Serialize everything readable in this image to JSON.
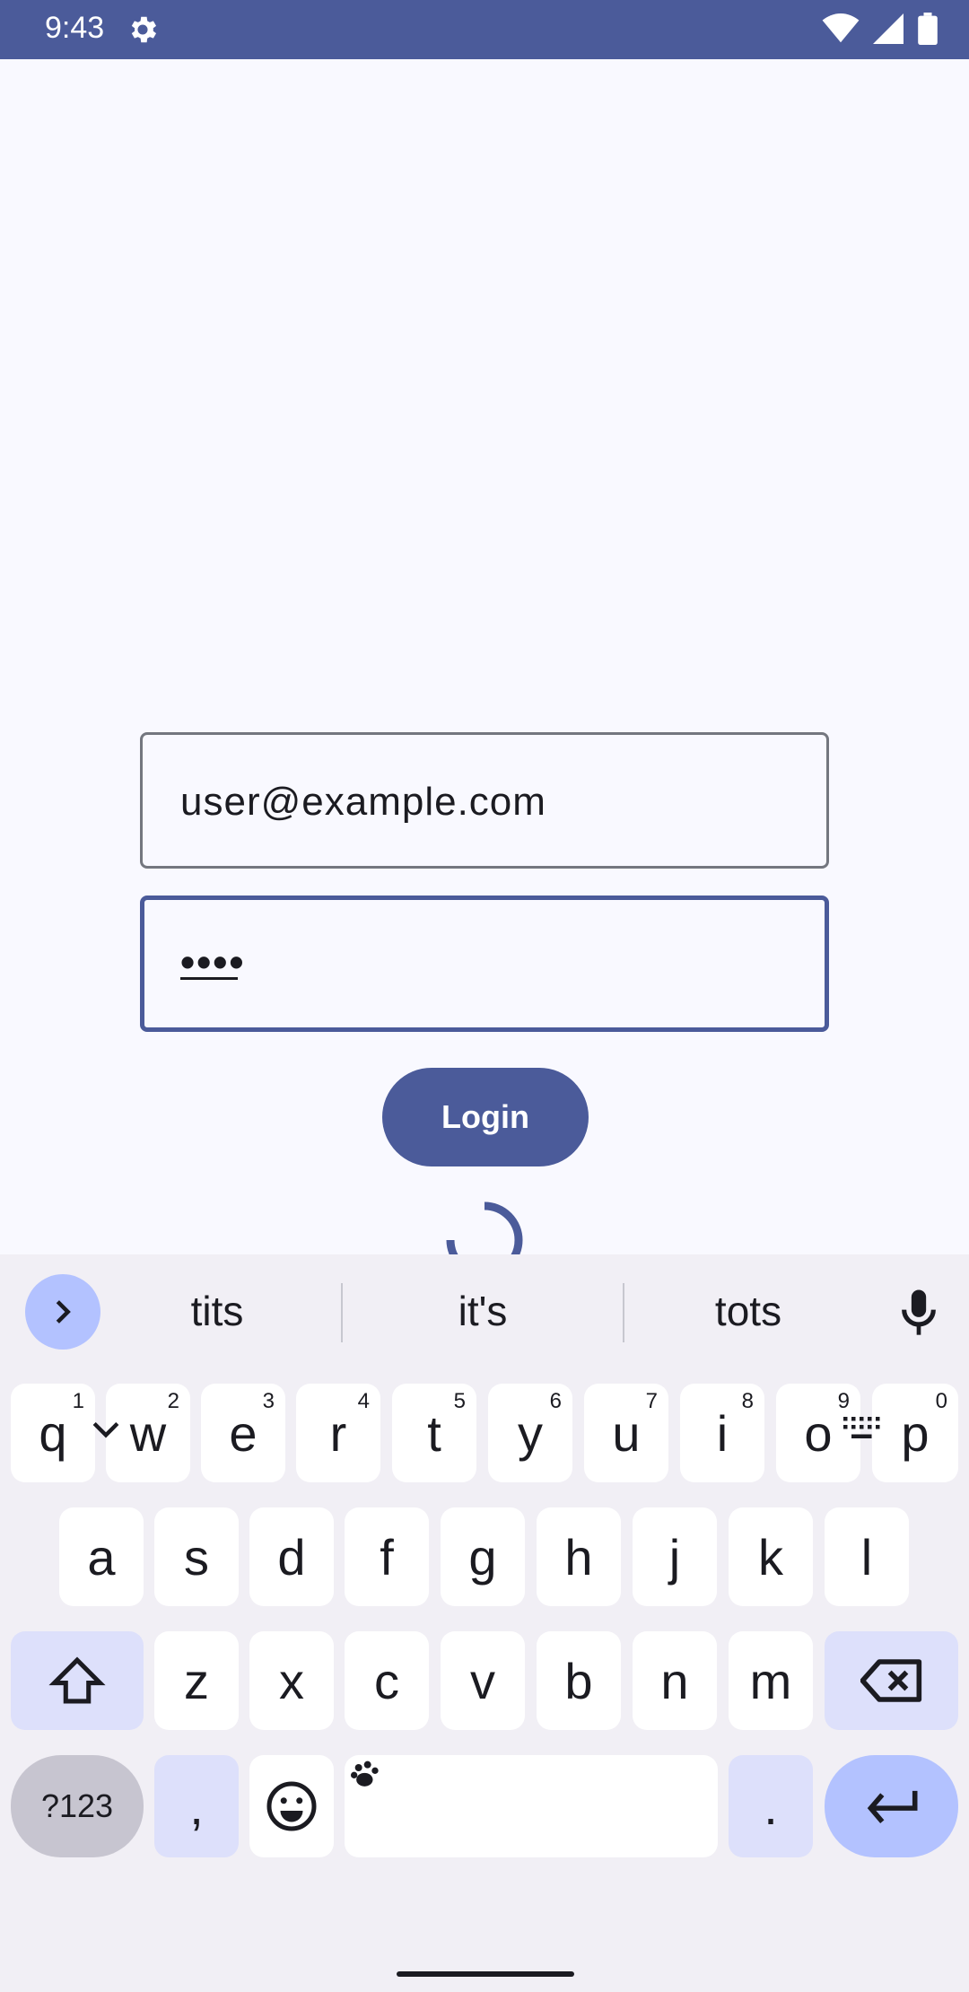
{
  "status_bar": {
    "time": "9:43",
    "icons": [
      "gear-icon",
      "wifi-icon",
      "signal-icon",
      "battery-icon"
    ]
  },
  "login_form": {
    "email_value": "user@example.com",
    "password_value": "••••",
    "login_label": "Login"
  },
  "colors": {
    "primary": "#4b5b9a",
    "background": "#f9f9ff",
    "keyboard_bg": "#f1eff5",
    "accent_key": "#b3c2ff"
  },
  "keyboard": {
    "suggestions": [
      "tits",
      "it's",
      "tots"
    ],
    "row1": [
      {
        "label": "q",
        "hint": "1"
      },
      {
        "label": "w",
        "hint": "2"
      },
      {
        "label": "e",
        "hint": "3"
      },
      {
        "label": "r",
        "hint": "4"
      },
      {
        "label": "t",
        "hint": "5"
      },
      {
        "label": "y",
        "hint": "6"
      },
      {
        "label": "u",
        "hint": "7"
      },
      {
        "label": "i",
        "hint": "8"
      },
      {
        "label": "o",
        "hint": "9"
      },
      {
        "label": "p",
        "hint": "0"
      }
    ],
    "row2": [
      "a",
      "s",
      "d",
      "f",
      "g",
      "h",
      "j",
      "k",
      "l"
    ],
    "row3": [
      "z",
      "x",
      "c",
      "v",
      "b",
      "n",
      "m"
    ],
    "symbols_label": "?123",
    "comma": ",",
    "period": "."
  }
}
